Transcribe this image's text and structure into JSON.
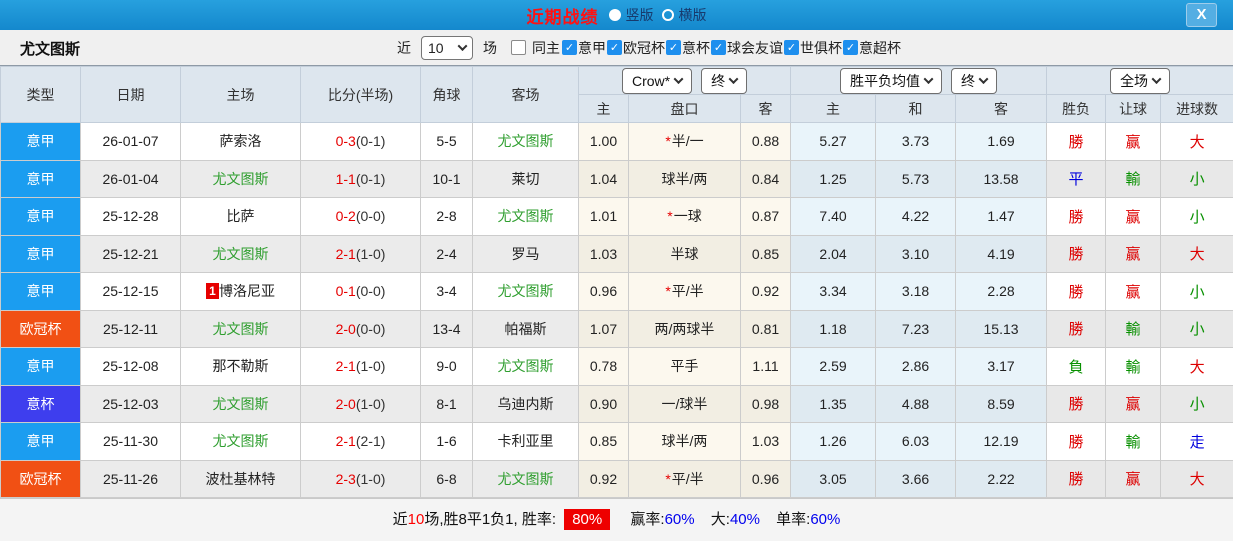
{
  "topbar": {
    "title": "近期战绩",
    "layout_vertical": "竖版",
    "layout_horizontal": "横版",
    "close_label": "X"
  },
  "filterbar": {
    "team_name": "尤文图斯",
    "recent_label": "近",
    "recent_count": "10",
    "matches_label": "场",
    "same_home_label": "同主",
    "same_home_checked": false,
    "competitions": [
      {
        "label": "意甲",
        "checked": true
      },
      {
        "label": "欧冠杯",
        "checked": true
      },
      {
        "label": "意杯",
        "checked": true
      },
      {
        "label": "球会友谊",
        "checked": true
      },
      {
        "label": "世俱杯",
        "checked": true
      },
      {
        "label": "意超杯",
        "checked": true
      }
    ]
  },
  "table": {
    "headers": {
      "type": "类型",
      "date": "日期",
      "home": "主场",
      "score": "比分(半场)",
      "corners": "角球",
      "away": "客场",
      "odds_home": "主",
      "odds_line": "盘口",
      "odds_away": "客",
      "avg_home": "主",
      "avg_draw": "和",
      "avg_away": "客",
      "result_wl": "胜负",
      "result_handicap": "让球",
      "result_goals": "进球数"
    },
    "dropdowns": {
      "odds_source": "Crow*",
      "odds_time": "终",
      "avg_label": "胜平负均值",
      "avg_time": "终",
      "period": "全场"
    },
    "rows": [
      {
        "type": "意甲",
        "date": "26-01-07",
        "home": "萨索洛",
        "home_highlight": false,
        "home_rank": "",
        "score": "0-3",
        "half": "(0-1)",
        "corners": "5-5",
        "away": "尤文图斯",
        "away_highlight": true,
        "odds_home": "1.00",
        "line_star": true,
        "line": "半/一",
        "odds_away": "0.88",
        "avg_home": "5.27",
        "avg_draw": "3.73",
        "avg_away": "1.69",
        "results": [
          {
            "t": "勝",
            "c": "r"
          },
          {
            "t": "赢",
            "c": "r"
          },
          {
            "t": "大",
            "c": "r"
          }
        ]
      },
      {
        "type": "意甲",
        "date": "26-01-04",
        "home": "尤文图斯",
        "home_highlight": true,
        "home_rank": "",
        "score": "1-1",
        "half": "(0-1)",
        "corners": "10-1",
        "away": "莱切",
        "away_highlight": false,
        "odds_home": "1.04",
        "line_star": false,
        "line": "球半/两",
        "odds_away": "0.84",
        "avg_home": "1.25",
        "avg_draw": "5.73",
        "avg_away": "13.58",
        "results": [
          {
            "t": "平",
            "c": "b"
          },
          {
            "t": "輸",
            "c": "g"
          },
          {
            "t": "小",
            "c": "g"
          }
        ]
      },
      {
        "type": "意甲",
        "date": "25-12-28",
        "home": "比萨",
        "home_highlight": false,
        "home_rank": "",
        "score": "0-2",
        "half": "(0-0)",
        "corners": "2-8",
        "away": "尤文图斯",
        "away_highlight": true,
        "odds_home": "1.01",
        "line_star": true,
        "line": "一球",
        "odds_away": "0.87",
        "avg_home": "7.40",
        "avg_draw": "4.22",
        "avg_away": "1.47",
        "results": [
          {
            "t": "勝",
            "c": "r"
          },
          {
            "t": "赢",
            "c": "r"
          },
          {
            "t": "小",
            "c": "g"
          }
        ]
      },
      {
        "type": "意甲",
        "date": "25-12-21",
        "home": "尤文图斯",
        "home_highlight": true,
        "home_rank": "",
        "score": "2-1",
        "half": "(1-0)",
        "corners": "2-4",
        "away": "罗马",
        "away_highlight": false,
        "odds_home": "1.03",
        "line_star": false,
        "line": "半球",
        "odds_away": "0.85",
        "avg_home": "2.04",
        "avg_draw": "3.10",
        "avg_away": "4.19",
        "results": [
          {
            "t": "勝",
            "c": "r"
          },
          {
            "t": "赢",
            "c": "r"
          },
          {
            "t": "大",
            "c": "r"
          }
        ]
      },
      {
        "type": "意甲",
        "date": "25-12-15",
        "home": "博洛尼亚",
        "home_highlight": false,
        "home_rank": "1",
        "score": "0-1",
        "half": "(0-0)",
        "corners": "3-4",
        "away": "尤文图斯",
        "away_highlight": true,
        "odds_home": "0.96",
        "line_star": true,
        "line": "平/半",
        "odds_away": "0.92",
        "avg_home": "3.34",
        "avg_draw": "3.18",
        "avg_away": "2.28",
        "results": [
          {
            "t": "勝",
            "c": "r"
          },
          {
            "t": "赢",
            "c": "r"
          },
          {
            "t": "小",
            "c": "g"
          }
        ]
      },
      {
        "type": "欧冠杯",
        "date": "25-12-11",
        "home": "尤文图斯",
        "home_highlight": true,
        "home_rank": "",
        "score": "2-0",
        "half": "(0-0)",
        "corners": "13-4",
        "away": "帕福斯",
        "away_highlight": false,
        "odds_home": "1.07",
        "line_star": false,
        "line": "两/两球半",
        "odds_away": "0.81",
        "avg_home": "1.18",
        "avg_draw": "7.23",
        "avg_away": "15.13",
        "results": [
          {
            "t": "勝",
            "c": "r"
          },
          {
            "t": "輸",
            "c": "g"
          },
          {
            "t": "小",
            "c": "g"
          }
        ]
      },
      {
        "type": "意甲",
        "date": "25-12-08",
        "home": "那不勒斯",
        "home_highlight": false,
        "home_rank": "",
        "score": "2-1",
        "half": "(1-0)",
        "corners": "9-0",
        "away": "尤文图斯",
        "away_highlight": true,
        "odds_home": "0.78",
        "line_star": false,
        "line": "平手",
        "odds_away": "1.11",
        "avg_home": "2.59",
        "avg_draw": "2.86",
        "avg_away": "3.17",
        "results": [
          {
            "t": "負",
            "c": "g"
          },
          {
            "t": "輸",
            "c": "g"
          },
          {
            "t": "大",
            "c": "r"
          }
        ]
      },
      {
        "type": "意杯",
        "date": "25-12-03",
        "home": "尤文图斯",
        "home_highlight": true,
        "home_rank": "",
        "score": "2-0",
        "half": "(1-0)",
        "corners": "8-1",
        "away": "乌迪内斯",
        "away_highlight": false,
        "odds_home": "0.90",
        "line_star": false,
        "line": "一/球半",
        "odds_away": "0.98",
        "avg_home": "1.35",
        "avg_draw": "4.88",
        "avg_away": "8.59",
        "results": [
          {
            "t": "勝",
            "c": "r"
          },
          {
            "t": "赢",
            "c": "r"
          },
          {
            "t": "小",
            "c": "g"
          }
        ]
      },
      {
        "type": "意甲",
        "date": "25-11-30",
        "home": "尤文图斯",
        "home_highlight": true,
        "home_rank": "",
        "score": "2-1",
        "half": "(2-1)",
        "corners": "1-6",
        "away": "卡利亚里",
        "away_highlight": false,
        "odds_home": "0.85",
        "line_star": false,
        "line": "球半/两",
        "odds_away": "1.03",
        "avg_home": "1.26",
        "avg_draw": "6.03",
        "avg_away": "12.19",
        "results": [
          {
            "t": "勝",
            "c": "r"
          },
          {
            "t": "輸",
            "c": "g"
          },
          {
            "t": "走",
            "c": "b"
          }
        ]
      },
      {
        "type": "欧冠杯",
        "date": "25-11-26",
        "home": "波杜基林特",
        "home_highlight": false,
        "home_rank": "",
        "score": "2-3",
        "half": "(1-0)",
        "corners": "6-8",
        "away": "尤文图斯",
        "away_highlight": true,
        "odds_home": "0.92",
        "line_star": true,
        "line": "平/半",
        "odds_away": "0.96",
        "avg_home": "3.05",
        "avg_draw": "3.66",
        "avg_away": "2.22",
        "results": [
          {
            "t": "勝",
            "c": "r"
          },
          {
            "t": "赢",
            "c": "r"
          },
          {
            "t": "大",
            "c": "r"
          }
        ]
      }
    ]
  },
  "footer": {
    "prefix": "近",
    "count": "10",
    "middle": "场,胜8平1负1, 胜率:",
    "win_rate": "80%",
    "win_label": "赢率:",
    "win_value": "60%",
    "big_label": "大:",
    "big_value": "40%",
    "single_label": "单率:",
    "single_value": "60%"
  },
  "colors": {
    "league_badges": {
      "意甲": "#1b9df0",
      "欧冠杯": "#f15014",
      "意杯": "#3e3eee"
    },
    "accent_red": "#dd0000",
    "accent_green": "#089000",
    "accent_blue": "#0000dd"
  }
}
